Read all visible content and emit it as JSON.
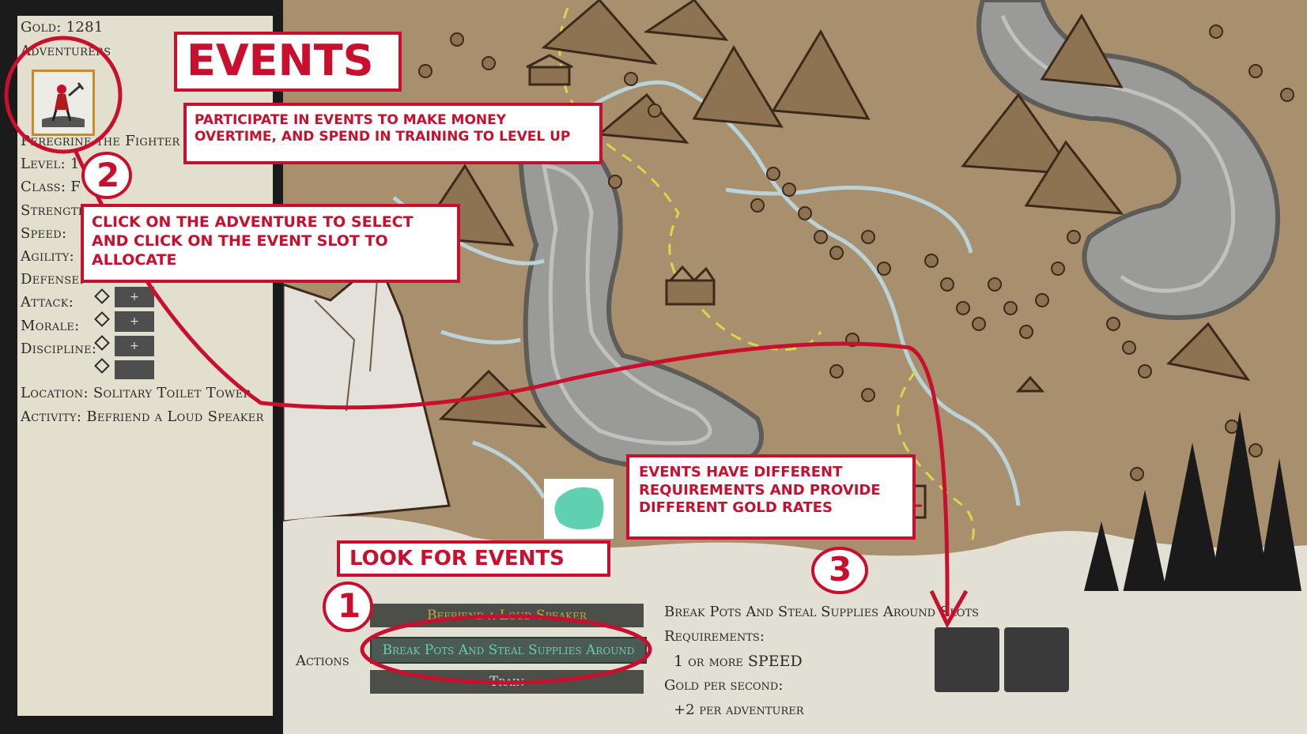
{
  "panel": {
    "gold_label": "Gold: 1281",
    "adventurers_label": "Adventurers",
    "name": "Peregrine the Fighter",
    "level": "Level: 1",
    "class": "Class: F",
    "strength": "Strength:",
    "speed": "Speed:",
    "agility": "Agility:",
    "defense": "Defense:",
    "attack": "Attack:",
    "morale": "Morale:",
    "discipline": "Discipline:",
    "plus": "+",
    "location": "Location: Solitary Toilet Tower",
    "activity": "Activity: Befriend a Loud Speaker"
  },
  "annotations": {
    "title": "EVENTS",
    "participate": "Participate in events to make money overtime, and spend in training to level up",
    "click": "Click on the adventure to select and click on the event slot to allocate",
    "requirements": "Events have different requirements and provide different gold rates",
    "look": "Look for events",
    "num1": "1",
    "num2": "2",
    "num3": "3"
  },
  "actions": {
    "label": "Actions",
    "buttons": [
      {
        "label": "Befriend a Loud Speaker",
        "color": "#c9a23a"
      },
      {
        "label": "Break Pots And Steal Supplies Around",
        "color": "#5fd1b0"
      },
      {
        "label": "Train",
        "color": "#cfcfcf"
      }
    ]
  },
  "event": {
    "title": "Break Pots And Steal Supplies Around",
    "slots_label": "Slots",
    "requirements_label": "Requirements:",
    "requirement": "1 or more SPEED",
    "gold_label": "Gold per second:",
    "gold_value": "+2 per adventurer"
  },
  "colors": {
    "annotation": "#c8102e",
    "map": "#a88f6d",
    "river": "#b9d3d8",
    "path": "#d8d84a"
  }
}
